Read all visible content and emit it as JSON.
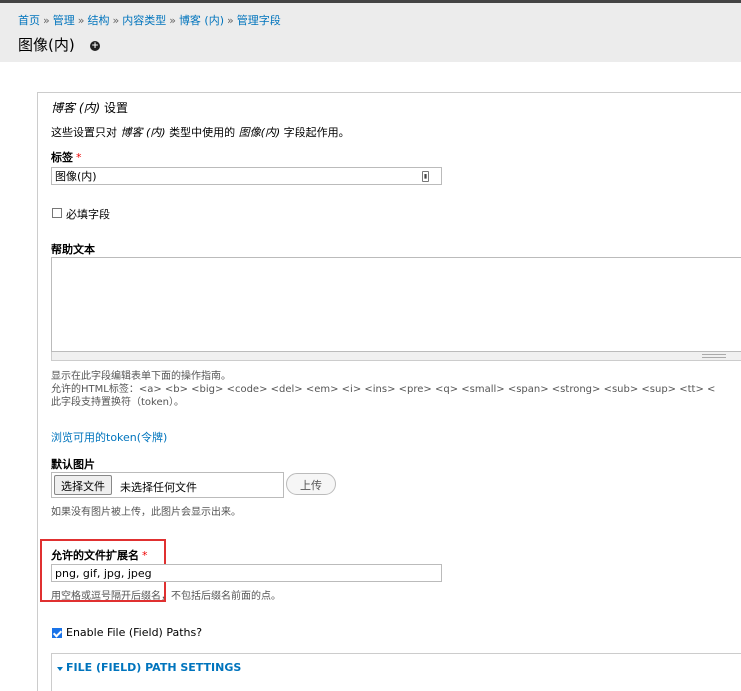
{
  "breadcrumb": [
    "首页",
    "管理",
    "结构",
    "内容类型",
    "博客 (内)",
    "管理字段"
  ],
  "breadcrumb_sep": "»",
  "page_title": "图像(内)",
  "add_shortcut_icon": "+",
  "settings": {
    "legend_italic": "博客 (内)",
    "legend_suffix": " 设置",
    "intro_prefix": "这些设置只对 ",
    "intro_type": "博客 (内)",
    "intro_middle": " 类型中使用的 ",
    "intro_field": "图像(内)",
    "intro_suffix": " 字段起作用。"
  },
  "label_field": {
    "label": "标签",
    "required_mark": "*",
    "value": "图像(内)"
  },
  "required_checkbox": {
    "label": "必填字段",
    "checked": false
  },
  "help_text": {
    "label": "帮助文本",
    "desc_line1": "显示在此字段编辑表单下面的操作指南。",
    "desc_line2": "允许的HTML标签：<a> <b> <big> <code> <del> <em> <i> <ins> <pre> <q> <small> <span> <strong> <sub> <sup> <tt> <",
    "desc_line3": "此字段支持置换符（token）。"
  },
  "token_link": "浏览可用的token(令牌)",
  "default_image": {
    "label": "默认图片",
    "choose_button": "选择文件",
    "no_file": "未选择任何文件",
    "upload_button": "上传",
    "desc": "如果没有图片被上传，此图片会显示出来。"
  },
  "extensions": {
    "label": "允许的文件扩展名",
    "required_mark": "*",
    "value": "png, gif, jpg, jpeg",
    "desc": "用空格或逗号隔开后缀名，不包括后缀名前面的点。"
  },
  "filefield_paths": {
    "label": "Enable File (Field) Paths?",
    "checked": true
  },
  "path_settings": {
    "title": "FILE (FIELD) PATH SETTINGS"
  },
  "colors": {
    "link": "#0074bd",
    "required": "#e00000",
    "highlight": "#e03030",
    "checkbox": "#1a73e8"
  }
}
